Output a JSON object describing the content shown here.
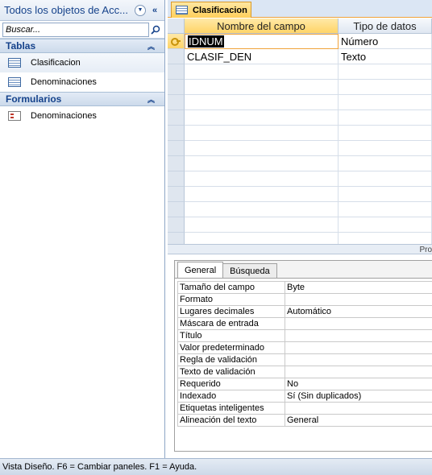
{
  "nav": {
    "title": "Todos los objetos de Acc...",
    "search_placeholder": "Buscar...",
    "groups": [
      {
        "label": "Tablas",
        "items": [
          {
            "label": "Clasificacion",
            "icon": "table-icon"
          },
          {
            "label": "Denominaciones",
            "icon": "table-icon"
          }
        ]
      },
      {
        "label": "Formularios",
        "items": [
          {
            "label": "Denominaciones",
            "icon": "form-icon"
          }
        ]
      }
    ]
  },
  "document": {
    "tab_label": "Clasificacion",
    "columns": [
      "Nombre del campo",
      "Tipo de datos"
    ],
    "rows": [
      {
        "field": "IDNUM",
        "type": "Número",
        "primary_key": true
      },
      {
        "field": "CLASIF_DEN",
        "type": "Texto",
        "primary_key": false
      }
    ],
    "splitter_label": "Pro"
  },
  "properties": {
    "tabs": [
      "General",
      "Búsqueda"
    ],
    "rows": [
      {
        "name": "Tamaño del campo",
        "value": "Byte"
      },
      {
        "name": "Formato",
        "value": ""
      },
      {
        "name": "Lugares decimales",
        "value": "Automático"
      },
      {
        "name": "Máscara de entrada",
        "value": ""
      },
      {
        "name": "Título",
        "value": ""
      },
      {
        "name": "Valor predeterminado",
        "value": ""
      },
      {
        "name": "Regla de validación",
        "value": ""
      },
      {
        "name": "Texto de validación",
        "value": ""
      },
      {
        "name": "Requerido",
        "value": "No"
      },
      {
        "name": "Indexado",
        "value": "Sí (Sin duplicados)"
      },
      {
        "name": "Etiquetas inteligentes",
        "value": ""
      },
      {
        "name": "Alineación del texto",
        "value": "General"
      }
    ]
  },
  "status": {
    "text": "Vista Diseño.  F6 = Cambiar paneles.  F1 = Ayuda."
  }
}
